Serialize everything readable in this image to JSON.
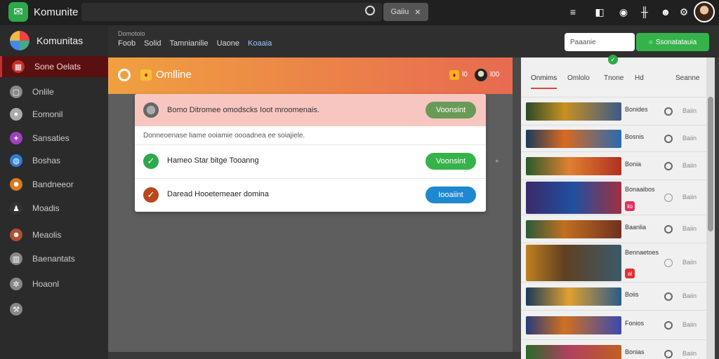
{
  "topbar": {
    "app_title": "Komunite",
    "search_placeholder": "",
    "search_button_label": "Gaiiu"
  },
  "sidebar": {
    "title": "Komunitas",
    "items": [
      {
        "label": "Sone Oelats",
        "icon": "grid-icon",
        "color": "#c43030"
      },
      {
        "label": "Onlile",
        "icon": "box-icon",
        "color": "#888888"
      },
      {
        "label": "Eomonil",
        "icon": "circle-icon",
        "color": "#aaaaaa"
      },
      {
        "label": "Sansaties",
        "icon": "game-icon",
        "color": "#a040c0"
      },
      {
        "label": "Boshas",
        "icon": "globe-icon",
        "color": "#2f7ed8"
      },
      {
        "label": "Bandneeor",
        "icon": "character-icon",
        "color": "#d87a20"
      },
      {
        "label": "Moadis",
        "icon": "hero-icon",
        "color": "#333333"
      },
      {
        "label": "Meaolis",
        "icon": "warrior-icon",
        "color": "#b05030"
      },
      {
        "label": "Baenantats",
        "icon": "building-icon",
        "color": "#888888"
      },
      {
        "label": "Hoaonl",
        "icon": "gear-icon",
        "color": "#888888"
      },
      {
        "label": "",
        "icon": "tools-icon",
        "color": "#888888"
      }
    ]
  },
  "subheader": {
    "crumb": "Domotoio",
    "tabs": [
      "Foob",
      "Solid",
      "Tamnianilie",
      "Uaone",
      "Koaaia"
    ],
    "input_value": "Paaanie",
    "button_label": "Ssonatatauia"
  },
  "main": {
    "banner_title": "Omlline",
    "banner_right_text_1": "l0",
    "banner_right_text_2": "l00",
    "alert_text": "Bomo Ditromee omodscks Ioot mroomenais.",
    "alert_button": "Voonsint",
    "description": "Donneoenase Iiame ooiamie oooadnea ee soiajiele.",
    "rows": [
      {
        "text": "Hameo Star bitge Tooanng",
        "button": "Voonsint",
        "icon_color": "#2ea84a",
        "button_color": "#2ea84a"
      },
      {
        "text": "Daread Hooetemeaer domina",
        "button": "Iooaiint",
        "icon_color": "#b8481e",
        "button_color": "#1e88d0"
      }
    ]
  },
  "right_panel": {
    "tabs": [
      "Onmims",
      "Omlolo",
      "Tnone",
      "Hd",
      "Seanne"
    ],
    "games": [
      {
        "name": "Bonides",
        "stat": "Baiin",
        "icon": "clock-icon",
        "badge": ""
      },
      {
        "name": "Bosnis",
        "stat": "Baiin",
        "icon": "clock-icon",
        "badge": ""
      },
      {
        "name": "Bonia",
        "stat": "Baiin",
        "icon": "clock-icon",
        "badge": ""
      },
      {
        "name": "Bonaaibos",
        "stat": "Baiin",
        "icon": "clock-icon",
        "badge": "ilo"
      },
      {
        "name": "Baanlia",
        "stat": "Baiin",
        "icon": "clock-icon",
        "badge": ""
      },
      {
        "name": "Bennaetoes",
        "stat": "Baiin",
        "icon": "clock-icon",
        "badge": "al"
      },
      {
        "name": "Boiis",
        "stat": "Baiin",
        "icon": "clock-icon",
        "badge": ""
      },
      {
        "name": "Fonios",
        "stat": "Baiin",
        "icon": "clock-icon",
        "badge": ""
      },
      {
        "name": "Bonias",
        "stat": "Baiin",
        "icon": "clock-icon",
        "badge": ""
      }
    ]
  },
  "colors": {
    "accent_green": "#35b34a",
    "accent_red": "#c43030",
    "banner_start": "#f0a040",
    "banner_end": "#e86a50"
  }
}
